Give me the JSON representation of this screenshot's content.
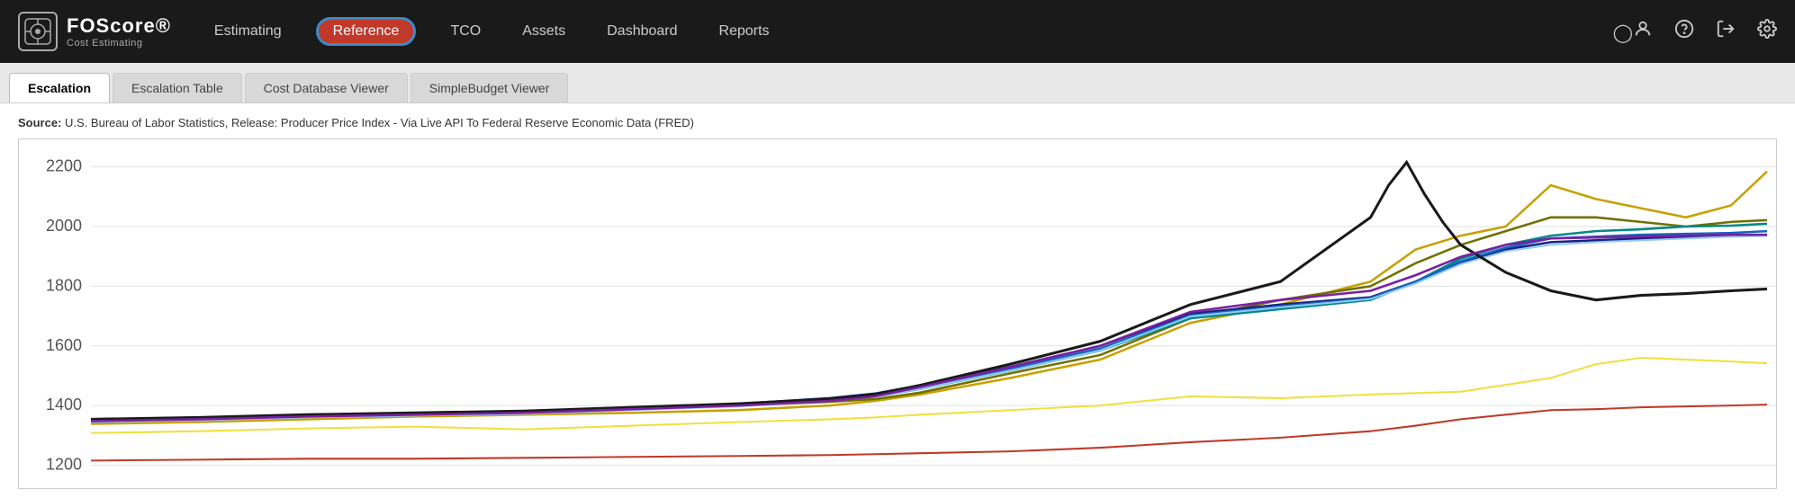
{
  "header": {
    "logo_name": "FOScore®",
    "logo_sub": "Cost Estimating",
    "nav": [
      {
        "id": "estimating",
        "label": "Estimating",
        "active": false
      },
      {
        "id": "reference",
        "label": "Reference",
        "active": true
      },
      {
        "id": "tco",
        "label": "TCO",
        "active": false
      },
      {
        "id": "assets",
        "label": "Assets",
        "active": false
      },
      {
        "id": "dashboard",
        "label": "Dashboard",
        "active": false
      },
      {
        "id": "reports",
        "label": "Reports",
        "active": false
      }
    ],
    "icons": [
      "user-icon",
      "help-icon",
      "logout-icon",
      "settings-icon"
    ]
  },
  "tabs": [
    {
      "id": "escalation",
      "label": "Escalation",
      "active": true
    },
    {
      "id": "escalation-table",
      "label": "Escalation Table",
      "active": false
    },
    {
      "id": "cost-database-viewer",
      "label": "Cost Database Viewer",
      "active": false
    },
    {
      "id": "simplebudget-viewer",
      "label": "SimpleBudget Viewer",
      "active": false
    }
  ],
  "source_label": "Source:",
  "source_text": " U.S. Bureau of Labor Statistics, Release: Producer Price Index  - Via Live API To Federal Reserve Economic Data (FRED)",
  "chart": {
    "y_labels": [
      "2200",
      "2000",
      "1800",
      "1600",
      "1400"
    ],
    "colors": {
      "black": "#1a1a1a",
      "gold": "#c8a000",
      "olive": "#808000",
      "teal": "#008080",
      "dark_blue": "#1a237e",
      "blue": "#1565c0",
      "light_blue": "#90caf9",
      "yellow": "#f9e400",
      "dark_yellow": "#b8860b",
      "red": "#c0392b",
      "purple": "#6a0dad"
    }
  }
}
